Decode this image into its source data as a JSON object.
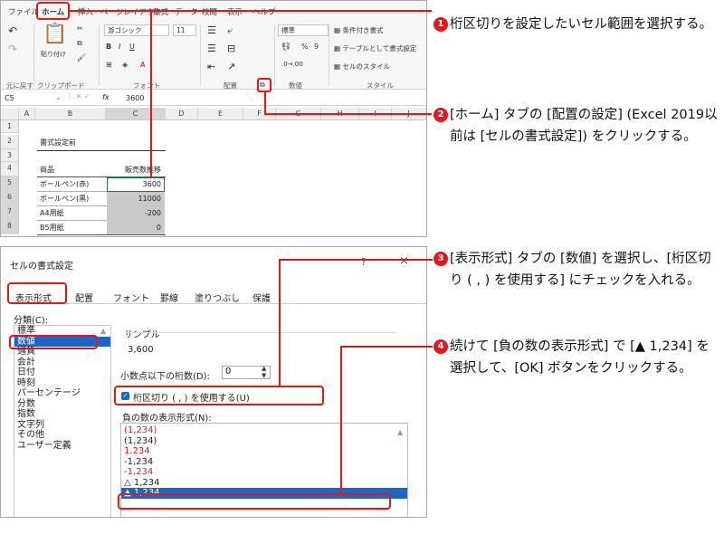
{
  "ribbon": {
    "tabs": [
      "ファイル",
      "ホーム",
      "挿入",
      "ページレイアウト",
      "数式",
      "データ",
      "校閲",
      "表示",
      "ヘルプ"
    ],
    "undo_group": "元に戻す",
    "clipboard_group": "クリップボード",
    "paste_label": "貼り付け",
    "font_name": "游ゴシック",
    "font_size": "11",
    "bold": "B",
    "italic": "I",
    "underline": "U",
    "font_group": "フォント",
    "align_group": "配置",
    "number_format": "標準",
    "percent": "%",
    "comma": "9",
    "number_group": "数値",
    "cond_format": "条件付き書式",
    "table_format": "テーブルとして書式設定",
    "cell_style": "セルのスタイル",
    "style_group": "スタイル"
  },
  "formula_bar": {
    "cell_ref": "C5",
    "fx": "fx",
    "value": "3600"
  },
  "sheet": {
    "columns": [
      "A",
      "B",
      "C",
      "D",
      "E",
      "F",
      "G",
      "H",
      "I",
      "J"
    ],
    "rows": [
      "1",
      "2",
      "3",
      "4",
      "5",
      "6",
      "7",
      "8"
    ],
    "title_cell": "書式設定前",
    "header_product": "商品",
    "header_qty": "販売数推移",
    "products": [
      "ボールペン(赤)",
      "ボールペン(黒)",
      "A4用紙",
      "B5用紙"
    ],
    "values": [
      "3600",
      "11000",
      "-200",
      "0"
    ]
  },
  "dialog": {
    "title": "セルの書式設定",
    "help": "?",
    "close": "×",
    "tabs": [
      "表示形式",
      "配置",
      "フォント",
      "罫線",
      "塗りつぶし",
      "保護"
    ],
    "category_label": "分類(C):",
    "categories": [
      "標準",
      "数値",
      "通貨",
      "会計",
      "日付",
      "時刻",
      "パーセンテージ",
      "分数",
      "指数",
      "文字列",
      "その他",
      "ユーザー定義"
    ],
    "sample_label": "サンプル",
    "sample_value": "3,600",
    "decimals_label": "小数点以下の桁数(D):",
    "decimals_value": "0",
    "separator_label": "桁区切り ( , ) を使用する(U)",
    "negative_label": "負の数の表示形式(N):",
    "negative_formats": [
      "(1,234)",
      "(1,234)",
      "1,234",
      "-1,234",
      "-1,234",
      "△ 1,234",
      "▲ 1,234"
    ]
  },
  "steps": [
    {
      "num": "1",
      "text": "桁区切りを設定したいセル範囲を選択する。"
    },
    {
      "num": "2",
      "text": "[ホーム] タブの [配置の設定] (Excel 2019以前は [セルの書式設定]) をクリックする。"
    },
    {
      "num": "3",
      "text": "[表示形式] タブの [数値] を選択し、[桁区切り ( , ) を使用する] にチェックを入れる。"
    },
    {
      "num": "4",
      "text": "続けて [負の数の表示形式] で [▲ 1,234] を選択して、[OK] ボタンをクリックする。"
    }
  ],
  "colors": {
    "accent_red": "#e5171a",
    "select_blue": "#1e66c6",
    "negative_red": "#d42020",
    "range_gray": "#c9c9c9"
  }
}
